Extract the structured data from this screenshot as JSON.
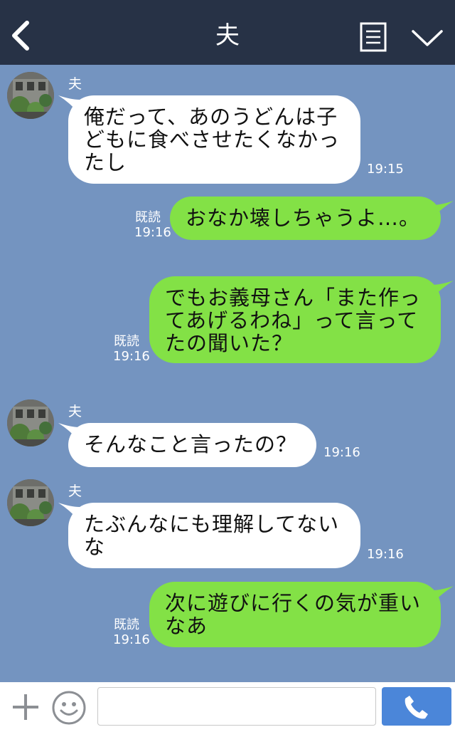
{
  "header": {
    "title": "夫"
  },
  "messages": [
    {
      "sender": "夫",
      "text": "俺だって、あのうどんは子\nどもに食べさせたくなかっ\nたし",
      "time": "19:15"
    },
    {
      "read": "既読",
      "time": "19:16",
      "text": "おなか壊しちゃうよ…。"
    },
    {
      "read": "既読",
      "time": "19:16",
      "text": "でもお義母さん「また作っ\nてあげるわね」って言って\nたの聞いた？"
    },
    {
      "sender": "夫",
      "text": "そんなこと言ったの？",
      "time": "19:16"
    },
    {
      "sender": "夫",
      "text": "たぶんなにも理解してない\nな",
      "time": "19:16"
    },
    {
      "read": "既読",
      "time": "19:16",
      "text": "次に遊びに行くの気が重い\nなあ"
    }
  ],
  "input": {
    "placeholder": ""
  },
  "icons": {
    "back": "chevron-left-icon",
    "notes": "notes-icon",
    "dropdown": "chevron-down-icon",
    "plus": "plus-icon",
    "emoji": "smiley-icon",
    "call": "phone-icon"
  },
  "colors": {
    "background": "#7494c0",
    "header": "#273246",
    "outgoing_bubble": "#83e146",
    "incoming_bubble": "#ffffff",
    "call_button": "#4b86d9"
  }
}
